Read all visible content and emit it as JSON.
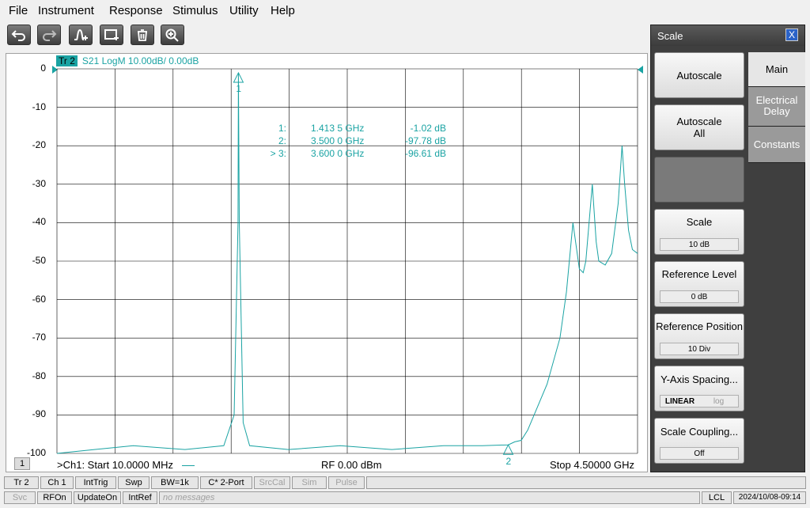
{
  "menu": [
    "File",
    "Instrument",
    "Response",
    "Stimulus",
    "Utility",
    "Help"
  ],
  "toolbar": {
    "buttons": [
      "undo-icon",
      "redo-icon",
      "marker-icon",
      "screen-capture-icon",
      "trash-icon",
      "zoom-icon"
    ]
  },
  "trace": {
    "badge": "Tr 2",
    "label": "S21 LogM 10.00dB/  0.00dB"
  },
  "markers": [
    {
      "id": "1:",
      "freq": "1.413 5 GHz",
      "value": "-1.02 dB"
    },
    {
      "id": "2:",
      "freq": "3.500 0 GHz",
      "value": "-97.78 dB"
    },
    {
      "id": "> 3:",
      "freq": "3.600 0 GHz",
      "value": "-96.61 dB"
    }
  ],
  "marker_flags": {
    "m1": "1",
    "m2": "2"
  },
  "footer": {
    "channel_badge": "1",
    "start": ">Ch1:  Start  10.0000 MHz",
    "rf": "RF    0.00 dBm",
    "stop": "Stop  4.50000 GHz"
  },
  "chart_data": {
    "type": "line",
    "xlabel": "",
    "ylabel": "",
    "xlim": [
      0.01,
      4.5
    ],
    "ylim": [
      -100,
      0
    ],
    "yticks": [
      "0",
      "-10",
      "-20",
      "-30",
      "-40",
      "-50",
      "-60",
      "-70",
      "-80",
      "-90",
      "-100"
    ],
    "grid": true,
    "series": [
      {
        "color": "#1aa3a3",
        "x": [
          0.01,
          0.3,
          0.6,
          1.0,
          1.3,
          1.38,
          1.41,
          1.4135,
          1.42,
          1.45,
          1.5,
          1.8,
          2.2,
          2.6,
          3.0,
          3.3,
          3.5,
          3.55,
          3.6,
          3.65,
          3.7,
          3.8,
          3.9,
          3.95,
          4.0,
          4.05,
          4.08,
          4.1,
          4.15,
          4.18,
          4.2,
          4.25,
          4.3,
          4.35,
          4.38,
          4.4,
          4.43,
          4.46,
          4.5
        ],
        "y": [
          -100,
          -99,
          -98,
          -99,
          -98,
          -90,
          -40,
          -1.02,
          -40,
          -92,
          -98,
          -99,
          -98,
          -99,
          -98,
          -98,
          -97.78,
          -97,
          -96.61,
          -94,
          -90,
          -82,
          -70,
          -58,
          -40,
          -52,
          -53,
          -50,
          -30,
          -45,
          -50,
          -51,
          -48,
          -35,
          -20,
          -30,
          -42,
          -47,
          -48
        ]
      }
    ]
  },
  "panel": {
    "title": "Scale",
    "close": "X",
    "autoscale": "Autoscale",
    "autoscale_all_1": "Autoscale",
    "autoscale_all_2": "All",
    "scale_label": "Scale",
    "scale_value": "10 dB",
    "ref_level_label": "Reference Level",
    "ref_level_value": "0 dB",
    "ref_pos_label": "Reference Position",
    "ref_pos_value": "10 Div",
    "y_axis_label": "Y-Axis Spacing...",
    "y_axis_linear": "LINEAR",
    "y_axis_log": "log",
    "coupling_label": "Scale Coupling...",
    "coupling_value": "Off",
    "tabs": [
      "Main",
      "Electrical Delay",
      "Constants"
    ]
  },
  "status_row1": [
    "Tr 2",
    "Ch 1",
    "IntTrig",
    "Swp",
    "BW=1k",
    "C* 2-Port",
    "SrcCal",
    "Sim",
    "Pulse"
  ],
  "status_row2": [
    "Svc",
    "RFOn",
    "UpdateOn",
    "IntRef",
    "no messages",
    "LCL",
    "2024/10/08-09:14"
  ]
}
